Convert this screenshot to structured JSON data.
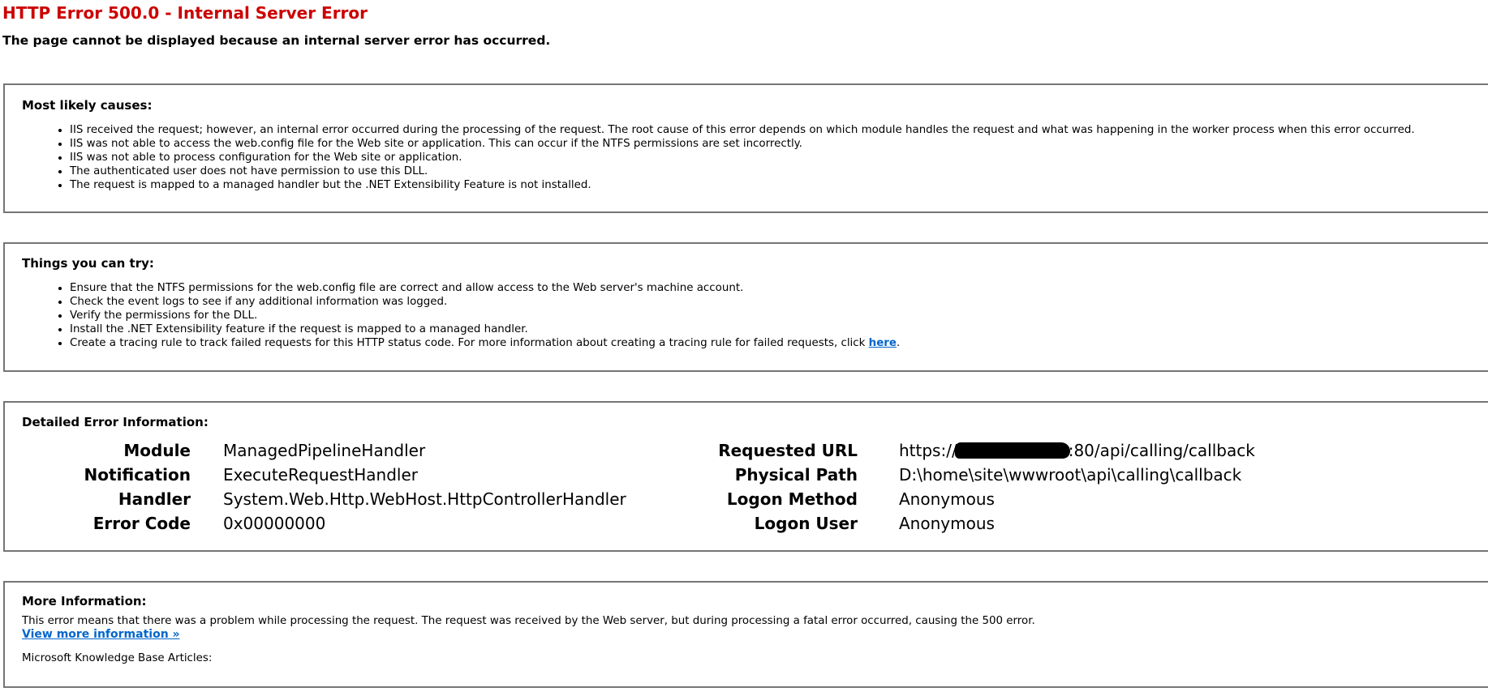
{
  "header": {
    "title": "HTTP Error 500.0 - Internal Server Error",
    "subtitle": "The page cannot be displayed because an internal server error has occurred."
  },
  "causes": {
    "heading": "Most likely causes:",
    "items": [
      "IIS received the request; however, an internal error occurred during the processing of the request. The root cause of this error depends on which module handles the request and what was happening in the worker process when this error occurred.",
      "IIS was not able to access the web.config file for the Web site or application. This can occur if the NTFS permissions are set incorrectly.",
      "IIS was not able to process configuration for the Web site or application.",
      "The authenticated user does not have permission to use this DLL.",
      "The request is mapped to a managed handler but the .NET Extensibility Feature is not installed."
    ]
  },
  "try": {
    "heading": "Things you can try:",
    "items": [
      "Ensure that the NTFS permissions for the web.config file are correct and allow access to the Web server's machine account.",
      "Check the event logs to see if any additional information was logged.",
      "Verify the permissions for the DLL.",
      "Install the .NET Extensibility feature if the request is mapped to a managed handler."
    ],
    "tracing_text": "Create a tracing rule to track failed requests for this HTTP status code. For more information about creating a tracing rule for failed requests, click ",
    "tracing_link": "here",
    "tracing_end": "."
  },
  "details": {
    "heading": "Detailed Error Information:",
    "left": [
      {
        "label": "Module",
        "value": "ManagedPipelineHandler"
      },
      {
        "label": "Notification",
        "value": "ExecuteRequestHandler"
      },
      {
        "label": "Handler",
        "value": "System.Web.Http.WebHost.HttpControllerHandler"
      },
      {
        "label": "Error Code",
        "value": "0x00000000"
      }
    ],
    "right": [
      {
        "label": "Requested URL",
        "value_prefix": "https://",
        "value_suffix": ":80/api/calling/callback"
      },
      {
        "label": "Physical Path",
        "value": "D:\\home\\site\\wwwroot\\api\\calling\\callback"
      },
      {
        "label": "Logon Method",
        "value": "Anonymous"
      },
      {
        "label": "Logon User",
        "value": "Anonymous"
      }
    ]
  },
  "more": {
    "heading": "More Information:",
    "text": "This error means that there was a problem while processing the request. The request was received by the Web server, but during processing a fatal error occurred, causing the 500 error.",
    "link": "View more information »",
    "kb": "Microsoft Knowledge Base Articles:"
  },
  "colors": {
    "title": "#cc0000",
    "link": "#0066cc",
    "border": "#757575"
  }
}
